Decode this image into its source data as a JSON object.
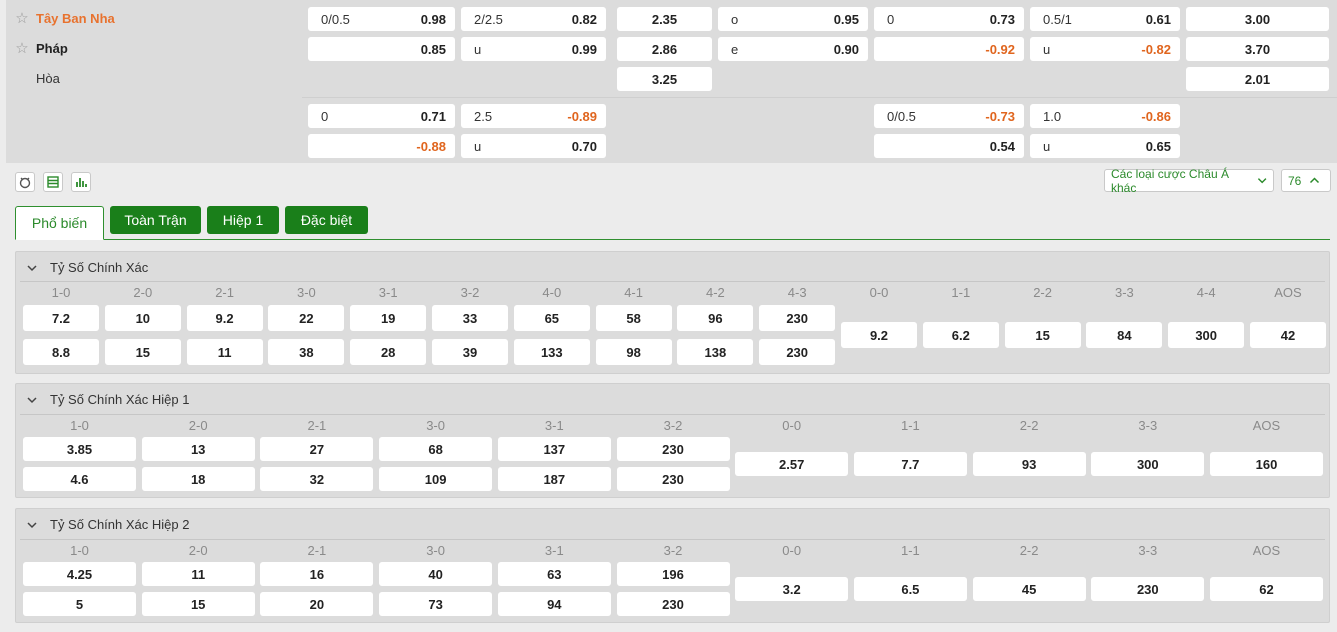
{
  "teams": {
    "home": "Tây Ban Nha",
    "away": "Pháp",
    "draw": "Hòa"
  },
  "odds_top": [
    {
      "row": 0,
      "col": 0,
      "lbl": "0/0.5",
      "val": "0.98"
    },
    {
      "row": 0,
      "col": 1,
      "lbl": "2/2.5",
      "val": "0.82"
    },
    {
      "row": 0,
      "col": 2,
      "lbl": "",
      "val": "2.35"
    },
    {
      "row": 0,
      "col": 3,
      "lbl": "o",
      "val": "0.95"
    },
    {
      "row": 0,
      "col": 4,
      "lbl": "0",
      "val": "0.73"
    },
    {
      "row": 0,
      "col": 5,
      "lbl": "0.5/1",
      "val": "0.61"
    },
    {
      "row": 0,
      "col": 6,
      "lbl": "",
      "val": "3.00"
    },
    {
      "row": 1,
      "col": 0,
      "lbl": "",
      "val": "0.85"
    },
    {
      "row": 1,
      "col": 1,
      "lbl": "u",
      "val": "0.99"
    },
    {
      "row": 1,
      "col": 2,
      "lbl": "",
      "val": "2.86"
    },
    {
      "row": 1,
      "col": 3,
      "lbl": "e",
      "val": "0.90"
    },
    {
      "row": 1,
      "col": 4,
      "lbl": "",
      "val": "-0.92"
    },
    {
      "row": 1,
      "col": 5,
      "lbl": "u",
      "val": "-0.82"
    },
    {
      "row": 1,
      "col": 6,
      "lbl": "",
      "val": "3.70"
    },
    {
      "row": 2,
      "col": 2,
      "lbl": "",
      "val": "3.25"
    },
    {
      "row": 2,
      "col": 6,
      "lbl": "",
      "val": "2.01"
    },
    {
      "row": 3,
      "col": 0,
      "lbl": "0",
      "val": "0.71"
    },
    {
      "row": 3,
      "col": 1,
      "lbl": "2.5",
      "val": "-0.89"
    },
    {
      "row": 3,
      "col": 4,
      "lbl": "0/0.5",
      "val": "-0.73"
    },
    {
      "row": 3,
      "col": 5,
      "lbl": "1.0",
      "val": "-0.86"
    },
    {
      "row": 4,
      "col": 0,
      "lbl": "",
      "val": "-0.88"
    },
    {
      "row": 4,
      "col": 1,
      "lbl": "u",
      "val": "0.70"
    },
    {
      "row": 4,
      "col": 4,
      "lbl": "",
      "val": "0.54"
    },
    {
      "row": 4,
      "col": 5,
      "lbl": "u",
      "val": "0.65"
    }
  ],
  "toolbar": {
    "dropdown_label": "Các loại cược Châu Á khác",
    "count_label": "76"
  },
  "tabs": [
    "Phổ biến",
    "Toàn Trận",
    "Hiệp 1",
    "Đặc biệt"
  ],
  "sections": [
    {
      "title": "Tỷ Số Chính Xác",
      "headers": [
        "1-0",
        "2-0",
        "2-1",
        "3-0",
        "3-1",
        "3-2",
        "4-0",
        "4-1",
        "4-2",
        "4-3",
        "0-0",
        "1-1",
        "2-2",
        "3-3",
        "4-4",
        "AOS"
      ],
      "home": [
        "7.2",
        "10",
        "9.2",
        "22",
        "19",
        "33",
        "65",
        "58",
        "96",
        "230"
      ],
      "away": [
        "8.8",
        "15",
        "11",
        "38",
        "28",
        "39",
        "133",
        "98",
        "138",
        "230"
      ],
      "draw": [
        "9.2",
        "6.2",
        "15",
        "84",
        "300",
        "42"
      ]
    },
    {
      "title": "Tỷ Số Chính Xác Hiệp 1",
      "headers": [
        "1-0",
        "2-0",
        "2-1",
        "3-0",
        "3-1",
        "3-2",
        "0-0",
        "1-1",
        "2-2",
        "3-3",
        "AOS"
      ],
      "home": [
        "3.85",
        "13",
        "27",
        "68",
        "137",
        "230"
      ],
      "away": [
        "4.6",
        "18",
        "32",
        "109",
        "187",
        "230"
      ],
      "draw": [
        "2.57",
        "7.7",
        "93",
        "300",
        "160"
      ]
    },
    {
      "title": "Tỷ Số Chính Xác Hiệp 2",
      "headers": [
        "1-0",
        "2-0",
        "2-1",
        "3-0",
        "3-1",
        "3-2",
        "0-0",
        "1-1",
        "2-2",
        "3-3",
        "AOS"
      ],
      "home": [
        "4.25",
        "11",
        "16",
        "40",
        "63",
        "196"
      ],
      "away": [
        "5",
        "15",
        "20",
        "73",
        "94",
        "230"
      ],
      "draw": [
        "3.2",
        "6.5",
        "45",
        "230",
        "62"
      ]
    }
  ],
  "colors": {
    "accent": "#1a7f1a",
    "home_team": "#e8722e",
    "negative": "#e0651e"
  },
  "icons": [
    "star-icon",
    "stats-icon",
    "list-icon",
    "chart-icon",
    "chevron-down-icon",
    "chevron-up-icon"
  ]
}
